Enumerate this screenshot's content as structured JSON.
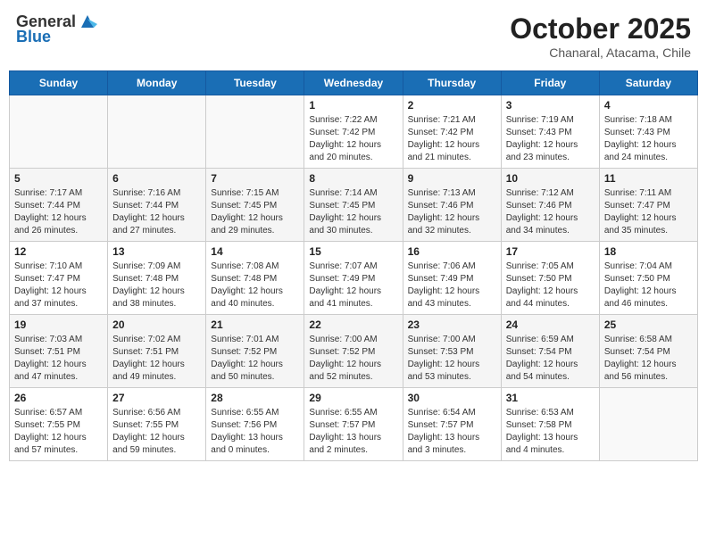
{
  "header": {
    "logo_general": "General",
    "logo_blue": "Blue",
    "month": "October 2025",
    "location": "Chanaral, Atacama, Chile"
  },
  "days_of_week": [
    "Sunday",
    "Monday",
    "Tuesday",
    "Wednesday",
    "Thursday",
    "Friday",
    "Saturday"
  ],
  "weeks": [
    [
      {
        "day": "",
        "sunrise": "",
        "sunset": "",
        "daylight": "",
        "empty": true
      },
      {
        "day": "",
        "sunrise": "",
        "sunset": "",
        "daylight": "",
        "empty": true
      },
      {
        "day": "",
        "sunrise": "",
        "sunset": "",
        "daylight": "",
        "empty": true
      },
      {
        "day": "1",
        "sunrise": "Sunrise: 7:22 AM",
        "sunset": "Sunset: 7:42 PM",
        "daylight": "Daylight: 12 hours and 20 minutes.",
        "empty": false
      },
      {
        "day": "2",
        "sunrise": "Sunrise: 7:21 AM",
        "sunset": "Sunset: 7:42 PM",
        "daylight": "Daylight: 12 hours and 21 minutes.",
        "empty": false
      },
      {
        "day": "3",
        "sunrise": "Sunrise: 7:19 AM",
        "sunset": "Sunset: 7:43 PM",
        "daylight": "Daylight: 12 hours and 23 minutes.",
        "empty": false
      },
      {
        "day": "4",
        "sunrise": "Sunrise: 7:18 AM",
        "sunset": "Sunset: 7:43 PM",
        "daylight": "Daylight: 12 hours and 24 minutes.",
        "empty": false
      }
    ],
    [
      {
        "day": "5",
        "sunrise": "Sunrise: 7:17 AM",
        "sunset": "Sunset: 7:44 PM",
        "daylight": "Daylight: 12 hours and 26 minutes.",
        "empty": false
      },
      {
        "day": "6",
        "sunrise": "Sunrise: 7:16 AM",
        "sunset": "Sunset: 7:44 PM",
        "daylight": "Daylight: 12 hours and 27 minutes.",
        "empty": false
      },
      {
        "day": "7",
        "sunrise": "Sunrise: 7:15 AM",
        "sunset": "Sunset: 7:45 PM",
        "daylight": "Daylight: 12 hours and 29 minutes.",
        "empty": false
      },
      {
        "day": "8",
        "sunrise": "Sunrise: 7:14 AM",
        "sunset": "Sunset: 7:45 PM",
        "daylight": "Daylight: 12 hours and 30 minutes.",
        "empty": false
      },
      {
        "day": "9",
        "sunrise": "Sunrise: 7:13 AM",
        "sunset": "Sunset: 7:46 PM",
        "daylight": "Daylight: 12 hours and 32 minutes.",
        "empty": false
      },
      {
        "day": "10",
        "sunrise": "Sunrise: 7:12 AM",
        "sunset": "Sunset: 7:46 PM",
        "daylight": "Daylight: 12 hours and 34 minutes.",
        "empty": false
      },
      {
        "day": "11",
        "sunrise": "Sunrise: 7:11 AM",
        "sunset": "Sunset: 7:47 PM",
        "daylight": "Daylight: 12 hours and 35 minutes.",
        "empty": false
      }
    ],
    [
      {
        "day": "12",
        "sunrise": "Sunrise: 7:10 AM",
        "sunset": "Sunset: 7:47 PM",
        "daylight": "Daylight: 12 hours and 37 minutes.",
        "empty": false
      },
      {
        "day": "13",
        "sunrise": "Sunrise: 7:09 AM",
        "sunset": "Sunset: 7:48 PM",
        "daylight": "Daylight: 12 hours and 38 minutes.",
        "empty": false
      },
      {
        "day": "14",
        "sunrise": "Sunrise: 7:08 AM",
        "sunset": "Sunset: 7:48 PM",
        "daylight": "Daylight: 12 hours and 40 minutes.",
        "empty": false
      },
      {
        "day": "15",
        "sunrise": "Sunrise: 7:07 AM",
        "sunset": "Sunset: 7:49 PM",
        "daylight": "Daylight: 12 hours and 41 minutes.",
        "empty": false
      },
      {
        "day": "16",
        "sunrise": "Sunrise: 7:06 AM",
        "sunset": "Sunset: 7:49 PM",
        "daylight": "Daylight: 12 hours and 43 minutes.",
        "empty": false
      },
      {
        "day": "17",
        "sunrise": "Sunrise: 7:05 AM",
        "sunset": "Sunset: 7:50 PM",
        "daylight": "Daylight: 12 hours and 44 minutes.",
        "empty": false
      },
      {
        "day": "18",
        "sunrise": "Sunrise: 7:04 AM",
        "sunset": "Sunset: 7:50 PM",
        "daylight": "Daylight: 12 hours and 46 minutes.",
        "empty": false
      }
    ],
    [
      {
        "day": "19",
        "sunrise": "Sunrise: 7:03 AM",
        "sunset": "Sunset: 7:51 PM",
        "daylight": "Daylight: 12 hours and 47 minutes.",
        "empty": false
      },
      {
        "day": "20",
        "sunrise": "Sunrise: 7:02 AM",
        "sunset": "Sunset: 7:51 PM",
        "daylight": "Daylight: 12 hours and 49 minutes.",
        "empty": false
      },
      {
        "day": "21",
        "sunrise": "Sunrise: 7:01 AM",
        "sunset": "Sunset: 7:52 PM",
        "daylight": "Daylight: 12 hours and 50 minutes.",
        "empty": false
      },
      {
        "day": "22",
        "sunrise": "Sunrise: 7:00 AM",
        "sunset": "Sunset: 7:52 PM",
        "daylight": "Daylight: 12 hours and 52 minutes.",
        "empty": false
      },
      {
        "day": "23",
        "sunrise": "Sunrise: 7:00 AM",
        "sunset": "Sunset: 7:53 PM",
        "daylight": "Daylight: 12 hours and 53 minutes.",
        "empty": false
      },
      {
        "day": "24",
        "sunrise": "Sunrise: 6:59 AM",
        "sunset": "Sunset: 7:54 PM",
        "daylight": "Daylight: 12 hours and 54 minutes.",
        "empty": false
      },
      {
        "day": "25",
        "sunrise": "Sunrise: 6:58 AM",
        "sunset": "Sunset: 7:54 PM",
        "daylight": "Daylight: 12 hours and 56 minutes.",
        "empty": false
      }
    ],
    [
      {
        "day": "26",
        "sunrise": "Sunrise: 6:57 AM",
        "sunset": "Sunset: 7:55 PM",
        "daylight": "Daylight: 12 hours and 57 minutes.",
        "empty": false
      },
      {
        "day": "27",
        "sunrise": "Sunrise: 6:56 AM",
        "sunset": "Sunset: 7:55 PM",
        "daylight": "Daylight: 12 hours and 59 minutes.",
        "empty": false
      },
      {
        "day": "28",
        "sunrise": "Sunrise: 6:55 AM",
        "sunset": "Sunset: 7:56 PM",
        "daylight": "Daylight: 13 hours and 0 minutes.",
        "empty": false
      },
      {
        "day": "29",
        "sunrise": "Sunrise: 6:55 AM",
        "sunset": "Sunset: 7:57 PM",
        "daylight": "Daylight: 13 hours and 2 minutes.",
        "empty": false
      },
      {
        "day": "30",
        "sunrise": "Sunrise: 6:54 AM",
        "sunset": "Sunset: 7:57 PM",
        "daylight": "Daylight: 13 hours and 3 minutes.",
        "empty": false
      },
      {
        "day": "31",
        "sunrise": "Sunrise: 6:53 AM",
        "sunset": "Sunset: 7:58 PM",
        "daylight": "Daylight: 13 hours and 4 minutes.",
        "empty": false
      },
      {
        "day": "",
        "sunrise": "",
        "sunset": "",
        "daylight": "",
        "empty": true
      }
    ]
  ]
}
